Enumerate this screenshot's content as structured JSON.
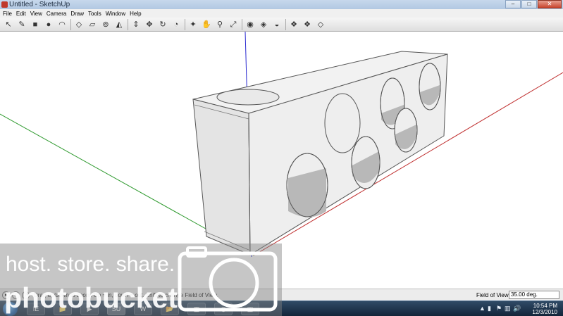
{
  "window": {
    "title": "Untitled - SketchUp",
    "controls": {
      "minimize": "–",
      "maximize": "□",
      "close": "✕"
    }
  },
  "menu": [
    "File",
    "Edit",
    "View",
    "Camera",
    "Draw",
    "Tools",
    "Window",
    "Help"
  ],
  "toolbar": {
    "tools": [
      {
        "name": "select-icon",
        "glyph": "↖"
      },
      {
        "name": "line-icon",
        "glyph": "✎"
      },
      {
        "name": "rectangle-icon",
        "glyph": "■"
      },
      {
        "name": "circle-icon",
        "glyph": "●"
      },
      {
        "name": "arc-icon",
        "glyph": "◠"
      },
      {
        "name": "sep"
      },
      {
        "name": "make-component-icon",
        "glyph": "◇"
      },
      {
        "name": "eraser-icon",
        "glyph": "▱"
      },
      {
        "name": "tape-measure-icon",
        "glyph": "⊚"
      },
      {
        "name": "paint-bucket-icon",
        "glyph": "◭"
      },
      {
        "name": "sep"
      },
      {
        "name": "push-pull-icon",
        "glyph": "⇕"
      },
      {
        "name": "move-icon",
        "glyph": "✥"
      },
      {
        "name": "rotate-icon",
        "glyph": "↻"
      },
      {
        "name": "offset-icon",
        "glyph": "◔"
      },
      {
        "name": "sep"
      },
      {
        "name": "orbit-icon",
        "glyph": "✦"
      },
      {
        "name": "pan-icon",
        "glyph": "✋"
      },
      {
        "name": "zoom-icon",
        "glyph": "⚲"
      },
      {
        "name": "zoom-extents-icon",
        "glyph": "⤢"
      },
      {
        "name": "sep"
      },
      {
        "name": "get-models-icon",
        "glyph": "◉"
      },
      {
        "name": "share-model-icon",
        "glyph": "◈"
      },
      {
        "name": "google-earth-icon",
        "glyph": "◒"
      },
      {
        "name": "sep"
      },
      {
        "name": "get-components-icon",
        "glyph": "❖"
      },
      {
        "name": "share-component-icon",
        "glyph": "❖"
      },
      {
        "name": "components-icon",
        "glyph": "◇"
      }
    ]
  },
  "status": {
    "text": "Drag up/down to zoom. Up = in, down = out. Shift to change Field of View.",
    "vcb_label": "Field of View",
    "vcb_value": "35.00 deg."
  },
  "taskbar": {
    "apps": [
      "IE",
      "📁",
      "▶",
      "SU",
      "W",
      "📂",
      "▦",
      "◎",
      "◫"
    ],
    "tray": [
      "▲",
      "▮",
      "⚑",
      "▥",
      "🔊"
    ],
    "time": "10:54 PM",
    "date": "12/3/2010"
  },
  "watermark": {
    "tagline": "host. store. share.",
    "brand": "photobucket"
  },
  "colors": {
    "axis_red": "#c03030",
    "axis_green": "#2e9a2e",
    "axis_blue": "#2a2ad0",
    "model_front": "#ededed",
    "model_top": "#f2f2f2",
    "model_side": "#e2e2e2",
    "hole_shadow": "#b8b8b8"
  }
}
